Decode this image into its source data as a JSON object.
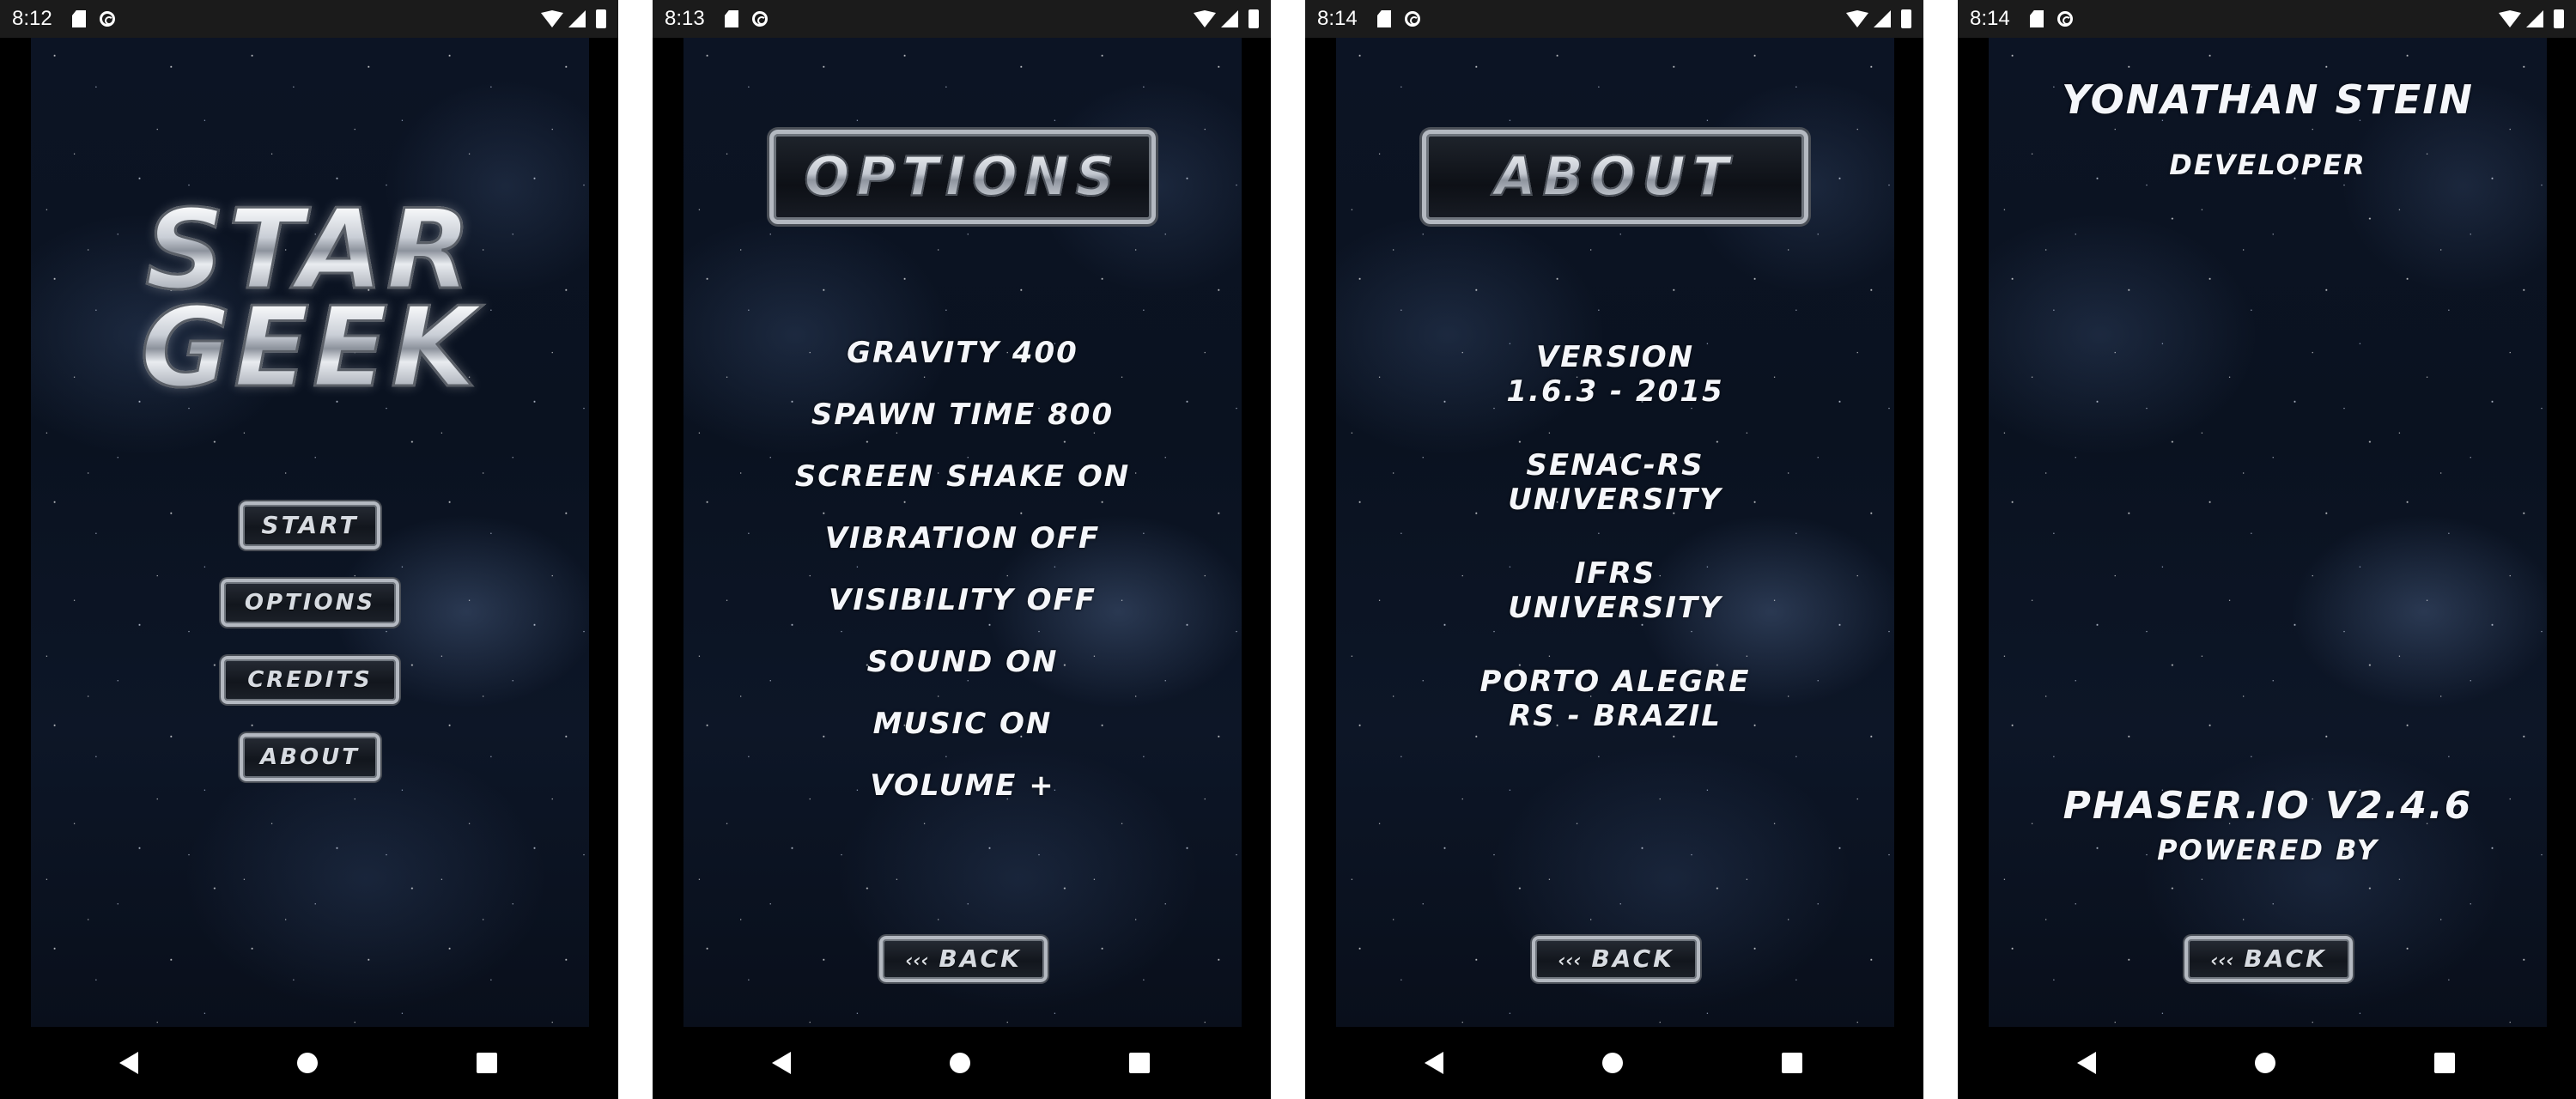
{
  "screens": {
    "menu": {
      "status_time": "8:12",
      "logo_line1": "STAR",
      "logo_line2": "GEEK",
      "buttons": {
        "start": "START",
        "options": "OPTIONS",
        "credits": "CREDITS",
        "about": "ABOUT"
      }
    },
    "options": {
      "status_time": "8:13",
      "title": "OPTIONS",
      "items": [
        "GRAVITY 400",
        "SPAWN TIME 800",
        "SCREEN SHAKE ON",
        "VIBRATION OFF",
        "VISIBILITY OFF",
        "SOUND ON",
        "MUSIC ON",
        "VOLUME +"
      ],
      "back_chevron": "‹‹‹",
      "back_label": "BACK"
    },
    "about": {
      "status_time": "8:14",
      "title": "ABOUT",
      "blocks": [
        {
          "line1": "VERSION",
          "line2": "1.6.3 - 2015"
        },
        {
          "line1": "SENAC-RS",
          "line2": "UNIVERSITY"
        },
        {
          "line1": "IFRS",
          "line2": "UNIVERSITY"
        },
        {
          "line1": "PORTO ALEGRE",
          "line2": "RS - BRAZIL"
        }
      ],
      "back_chevron": "‹‹‹",
      "back_label": "BACK"
    },
    "credits": {
      "status_time": "8:14",
      "name": "YONATHAN STEIN",
      "role": "DEVELOPER",
      "engine": "PHASER.IO V2.4.6",
      "powered": "POWERED BY",
      "back_chevron": "‹‹‹",
      "back_label": "BACK"
    }
  },
  "icons": {
    "status": [
      "sd-card-icon",
      "do-not-disturb-icon",
      "wifi-icon",
      "signal-icon",
      "battery-icon"
    ],
    "nav": [
      "nav-back-icon",
      "nav-home-icon",
      "nav-recents-icon"
    ]
  },
  "colors": {
    "status_bar": "#1b1b1b",
    "text": "#f4f6fa",
    "metal": "#b4b9c1",
    "space": "#0a1220"
  }
}
